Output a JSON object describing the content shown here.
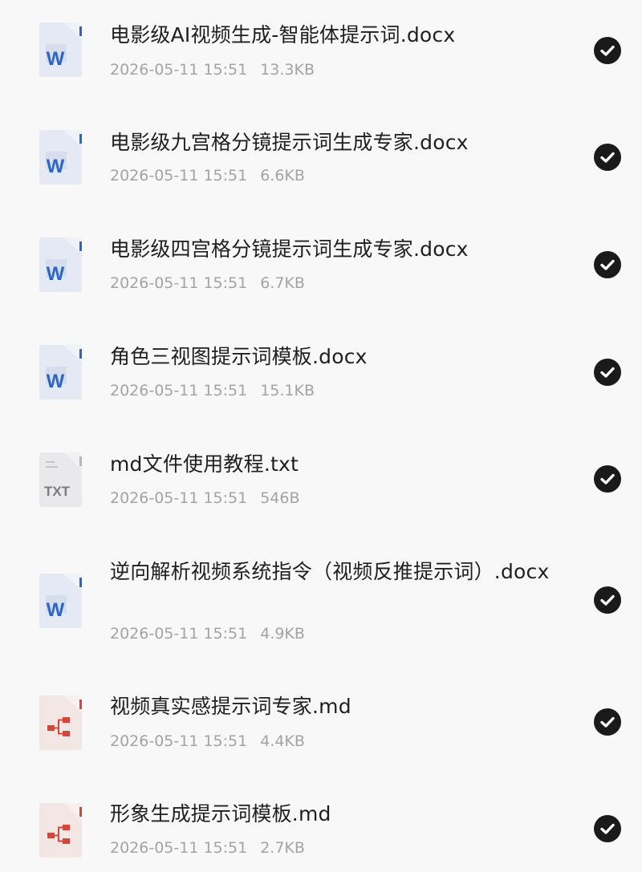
{
  "files": [
    {
      "name": "电影级AI视频生成-智能体提示词.docx",
      "date": "2026-05-11 15:51",
      "size": "13.3KB",
      "icon": "word-doc-icon",
      "selected": true
    },
    {
      "name": "电影级九宫格分镜提示词生成专家.docx",
      "date": "2026-05-11 15:51",
      "size": "6.6KB",
      "icon": "word-doc-icon",
      "selected": true
    },
    {
      "name": "电影级四宫格分镜提示词生成专家.docx",
      "date": "2026-05-11 15:51",
      "size": "6.7KB",
      "icon": "word-doc-icon",
      "selected": true
    },
    {
      "name": "角色三视图提示词模板.docx",
      "date": "2026-05-11 15:51",
      "size": "15.1KB",
      "icon": "word-doc-icon",
      "selected": true
    },
    {
      "name": "md文件使用教程.txt",
      "date": "2026-05-11 15:51",
      "size": "546B",
      "icon": "txt-file-icon",
      "icon_label": "TXT",
      "selected": true
    },
    {
      "name": "逆向解析视频系统指令（视频反推提示词）.docx",
      "date": "2026-05-11 15:51",
      "size": "4.9KB",
      "icon": "word-doc-icon",
      "selected": true
    },
    {
      "name": "视频真实感提示词专家.md",
      "date": "2026-05-11 15:51",
      "size": "4.4KB",
      "icon": "markdown-file-icon",
      "selected": true
    },
    {
      "name": "形象生成提示词模板.md",
      "date": "2026-05-11 15:51",
      "size": "2.7KB",
      "icon": "markdown-file-icon",
      "selected": true
    }
  ],
  "colors": {
    "background": "#f8f8f8",
    "title_text": "#1f1f1f",
    "meta_text": "#a3a3a3",
    "word_blue": "#2b66c2",
    "md_red": "#d2473c",
    "check_fill": "#1a1a1a"
  }
}
